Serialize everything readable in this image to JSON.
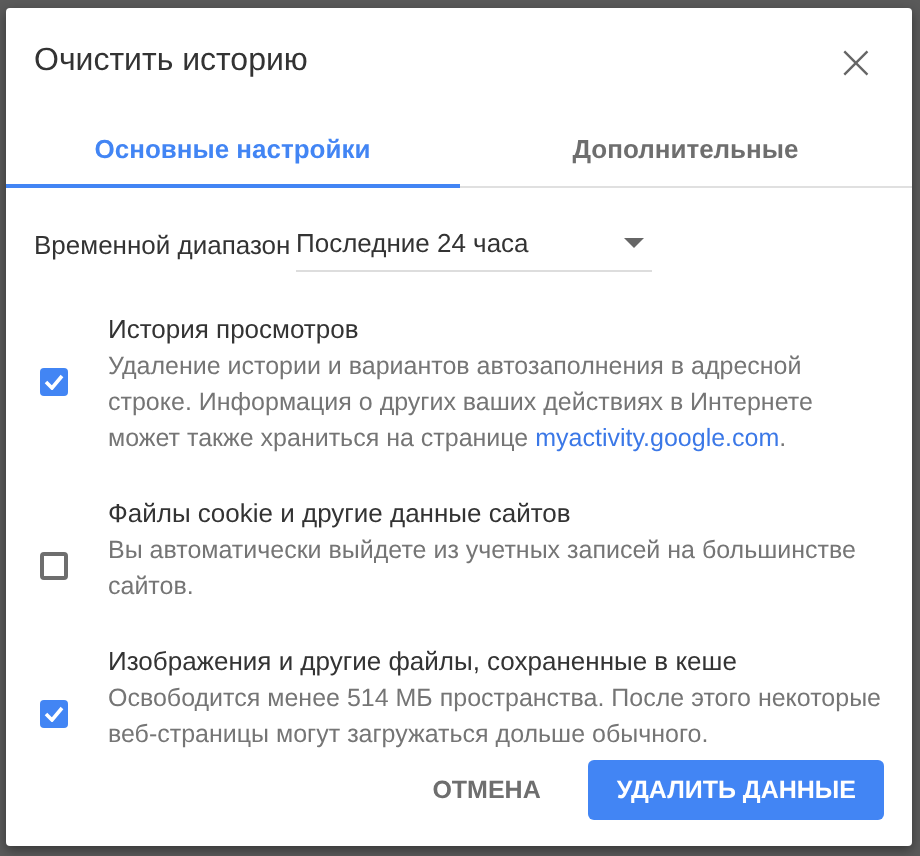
{
  "dialog": {
    "title": "Очистить историю",
    "close": "×"
  },
  "tabs": [
    {
      "label": "Основные настройки",
      "selected": true
    },
    {
      "label": "Дополнительные",
      "selected": false
    }
  ],
  "time_range": {
    "label": "Временной диапазон",
    "value": "Последние 24 часа"
  },
  "options": [
    {
      "title": "История просмотров",
      "description": "Удаление истории и вариантов автозаполнения в адресной строке. Информация о других ваших действиях в Интернете может также храниться на странице ",
      "link": "myactivity.google.com",
      "after_link": ".",
      "checked": true
    },
    {
      "title": "Файлы cookie и другие данные сайтов",
      "description": "Вы автоматически выйдете из учетных записей на большинстве сайтов.",
      "checked": false
    },
    {
      "title": "Изображения и другие файлы, сохраненные в кеше",
      "description": "Освободится менее 514 МБ пространства. После этого некоторые веб-страницы могут загружаться дольше обычного.",
      "checked": true
    }
  ],
  "buttons": [
    {
      "label": "ОТМЕНА",
      "kind": "text"
    },
    {
      "label": "УДАЛИТЬ ДАННЫЕ",
      "kind": "primary"
    }
  ]
}
